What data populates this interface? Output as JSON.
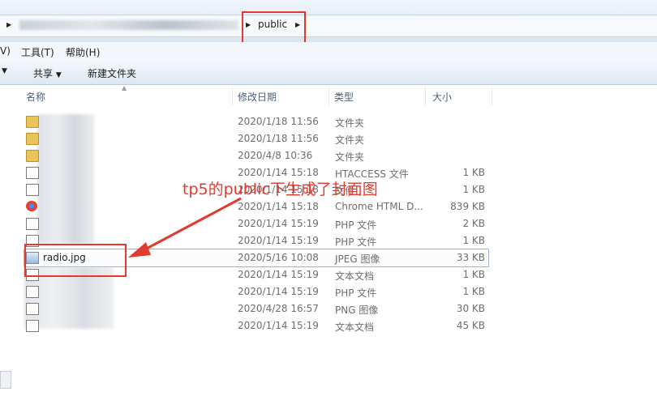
{
  "address": {
    "folder": "public"
  },
  "menu": {
    "v_partial": "V)",
    "tools": "工具(T)",
    "help": "帮助(H)"
  },
  "toolbar": {
    "share": "共享",
    "new_folder": "新建文件夹"
  },
  "columns": {
    "name": "名称",
    "date": "修改日期",
    "type": "类型",
    "size": "大小"
  },
  "files": [
    {
      "name": "",
      "date": "2020/1/18 11:56",
      "type": "文件夹",
      "size": "",
      "icon": "folder-icon"
    },
    {
      "name": "",
      "date": "2020/1/18 11:56",
      "type": "文件夹",
      "size": "",
      "icon": "folder-icon"
    },
    {
      "name": "",
      "date": "2020/4/8 10:36",
      "type": "文件夹",
      "size": "",
      "icon": "folder-icon"
    },
    {
      "name": "",
      "date": "2020/1/14 15:18",
      "type": "HTACCESS 文件",
      "size": "1 KB",
      "icon": "file-icon"
    },
    {
      "name": "",
      "date": "2020/1/14 15:18",
      "type": "文件",
      "size": "1 KB",
      "icon": "file-icon"
    },
    {
      "name": "",
      "date": "2020/1/14 15:18",
      "type": "Chrome HTML D...",
      "size": "839 KB",
      "icon": "chrome-icon"
    },
    {
      "name": "",
      "date": "2020/1/14 15:19",
      "type": "PHP 文件",
      "size": "2 KB",
      "icon": "file-icon"
    },
    {
      "name": "",
      "date": "2020/1/14 15:19",
      "type": "PHP 文件",
      "size": "1 KB",
      "icon": "file-icon"
    },
    {
      "name": "radio.jpg",
      "date": "2020/5/16 10:08",
      "type": "JPEG 图像",
      "size": "33 KB",
      "icon": "image-icon"
    },
    {
      "name": "",
      "date": "2020/1/14 15:19",
      "type": "文本文档",
      "size": "1 KB",
      "icon": "file-icon"
    },
    {
      "name": "",
      "date": "2020/1/14 15:19",
      "type": "PHP 文件",
      "size": "1 KB",
      "icon": "file-icon"
    },
    {
      "name": "",
      "date": "2020/4/28 16:57",
      "type": "PNG 图像",
      "size": "30 KB",
      "icon": "file-icon"
    },
    {
      "name": "",
      "date": "2020/1/14 15:19",
      "type": "文本文档",
      "size": "45 KB",
      "icon": "file-icon"
    }
  ],
  "annotation": {
    "text": "tp5的public下生成了封面图",
    "color": "#e33a2f"
  }
}
